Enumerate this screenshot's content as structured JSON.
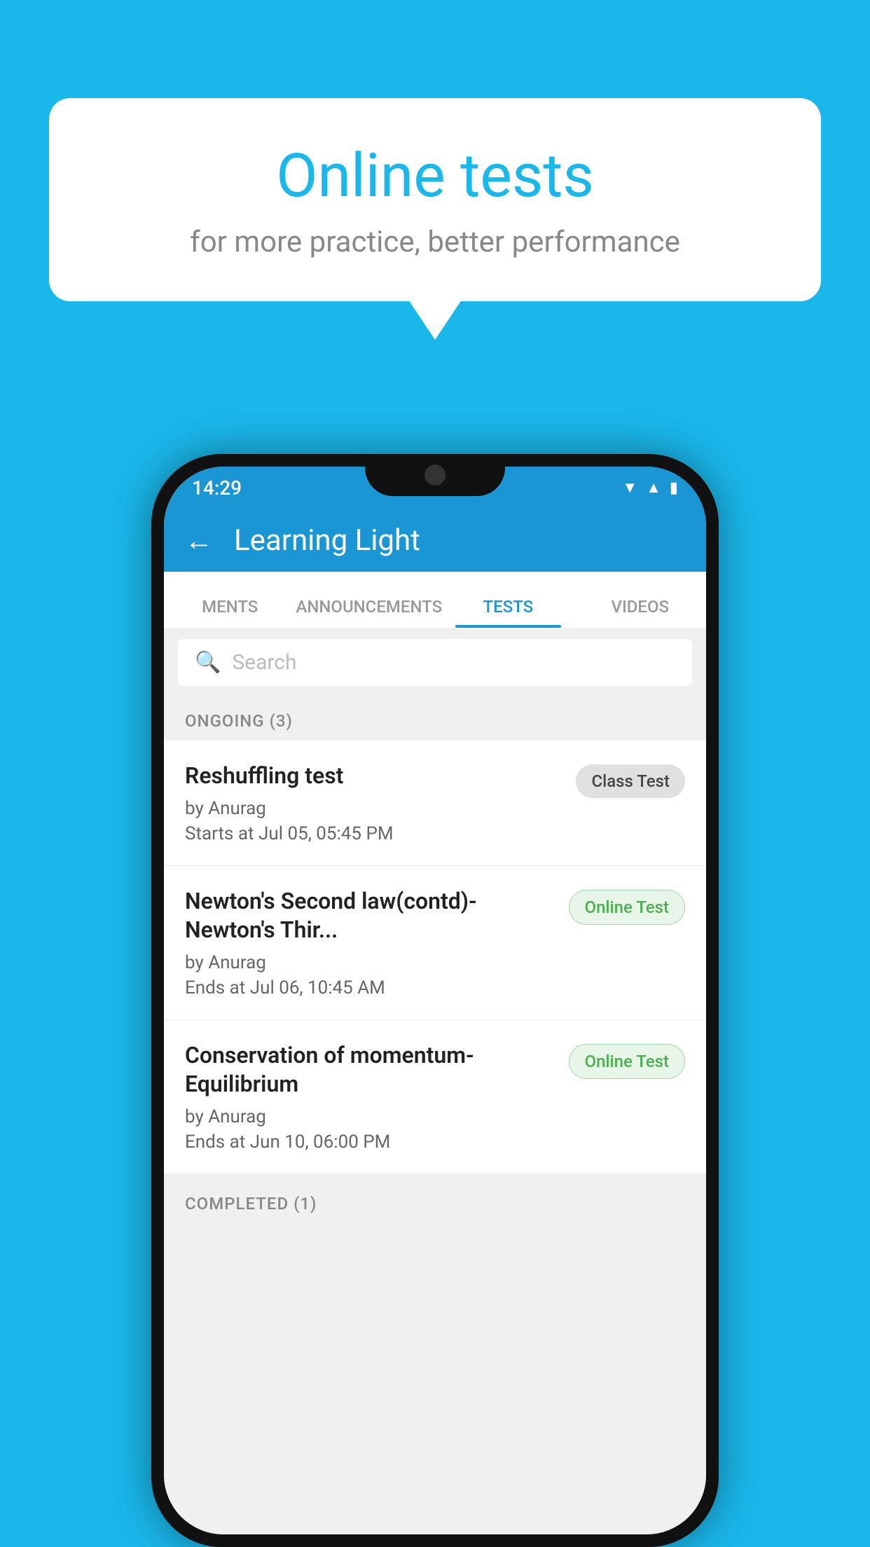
{
  "background": {
    "color": "#1ab7ea"
  },
  "speech_bubble": {
    "title": "Online tests",
    "subtitle": "for more practice, better performance"
  },
  "phone": {
    "status_bar": {
      "time": "14:29",
      "icons": [
        "wifi",
        "signal",
        "battery"
      ]
    },
    "header": {
      "back_label": "←",
      "title": "Learning Light"
    },
    "tabs": [
      {
        "label": "MENTS",
        "active": false
      },
      {
        "label": "ANNOUNCEMENTS",
        "active": false
      },
      {
        "label": "TESTS",
        "active": true
      },
      {
        "label": "VIDEOS",
        "active": false
      }
    ],
    "search": {
      "placeholder": "Search"
    },
    "ongoing_section": {
      "header": "ONGOING (3)",
      "tests": [
        {
          "title": "Reshuffling test",
          "author": "by Anurag",
          "time_label": "Starts at",
          "time_value": "Jul 05, 05:45 PM",
          "badge": "Class Test",
          "badge_type": "class"
        },
        {
          "title": "Newton's Second law(contd)-Newton's Thir...",
          "author": "by Anurag",
          "time_label": "Ends at",
          "time_value": "Jul 06, 10:45 AM",
          "badge": "Online Test",
          "badge_type": "online"
        },
        {
          "title": "Conservation of momentum-Equilibrium",
          "author": "by Anurag",
          "time_label": "Ends at",
          "time_value": "Jun 10, 06:00 PM",
          "badge": "Online Test",
          "badge_type": "online"
        }
      ]
    },
    "completed_section": {
      "header": "COMPLETED (1)"
    }
  }
}
